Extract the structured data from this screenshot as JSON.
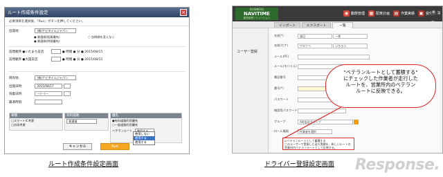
{
  "left_dialog": {
    "title": "ルート作成条件設定",
    "close": "×",
    "hint": "必要項目を選択後、『Run』ボタンを押してください。",
    "rows": [
      {
        "label": "出発地:",
        "value": "(株)ナビタイムジャパン"
      },
      {
        "label": "目的地:",
        "value": "(株)ナビタイムジャパン"
      },
      {
        "label": "出発日時:",
        "value": "2015/08/17"
      },
      {
        "label": "到着日時:",
        "value": "---/---/---"
      },
      {
        "label": "最適時刻:",
        "value": ""
      }
    ],
    "radio_1": "● 最適順(距離優先)",
    "radio_2": "○ 訪問順を変えない",
    "radio_3": "● 最適順(時間優先)",
    "stop_1": "訪問順序 ●いたまち支店",
    "stop_2": "訪問順序 ●大田支店",
    "time_1": "● 時間 ● 分 ● 2015/08/15",
    "time_2": "● 時間 ● 分 ● 2015/08/15",
    "panels": [
      {
        "head": "車種",
        "line1": "□スマートIC考慮",
        "line2": "□渋滞考慮"
      },
      {
        "head": "有料道路",
        "line1": "普通道",
        "line2": ""
      },
      {
        "head": "優先",
        "line1": "●有料道路利用優先",
        "line2": "○一般道路利用優先"
      }
    ],
    "veteran_label": "ベテランルート",
    "veteran_value": "使用する",
    "popup_options": [
      "使用しない",
      "使用する",
      "使用する"
    ],
    "cancel": "キャンセル",
    "run": "Run"
  },
  "right_app": {
    "logo_top": "BUSINESS",
    "logo_main": "NAVITIME",
    "logo_sub": "動態管理ソリューション",
    "nav": [
      "動態管理",
      "配車計画",
      "作業実績",
      "受付",
      "設定"
    ],
    "tabs": [
      "インポート",
      "エクスポート",
      "一覧"
    ],
    "side_title": "ユーザー登録",
    "fields": [
      {
        "k": "名前(*)",
        "v1": "渡辺",
        "v2": "一郎"
      },
      {
        "k": "名前(カナ)",
        "v1": "ワタナベ",
        "v2": "いちろう"
      },
      {
        "k": "メール(PC)",
        "v1": "",
        "v2": ""
      },
      {
        "k": "メール(モバイル)",
        "v1": "",
        "v2": ""
      },
      {
        "k": "電話番号",
        "v1": "",
        "v2": ""
      },
      {
        "k": "番号(*)",
        "v1": "",
        "v2": ""
      },
      {
        "k": "パスワード",
        "v1": "",
        "v2": ""
      },
      {
        "k": "確認用パスワード",
        "v1": "",
        "v2": ""
      },
      {
        "k": "グループ",
        "v1": "A町配送グループ",
        "v2": ""
      },
      {
        "k": "ロール権限",
        "v1": "作業者を選択",
        "v2": ""
      }
    ],
    "check_text": "☑ベテランルートとして蓄積する\nこのユーザーで実施した走行実績を、新しいルートの営業所内ベテランルートとして反映する。"
  },
  "callout": "\"ベテランルートとして蓄積する\"\nにチェックした作業者が走行した\nルートを、営業所内のベテラン\nルートに反映できる。",
  "captions": {
    "left": "ルート作成条件設定画面",
    "right": "ドライバー登録設定画面"
  },
  "watermark": "Response."
}
